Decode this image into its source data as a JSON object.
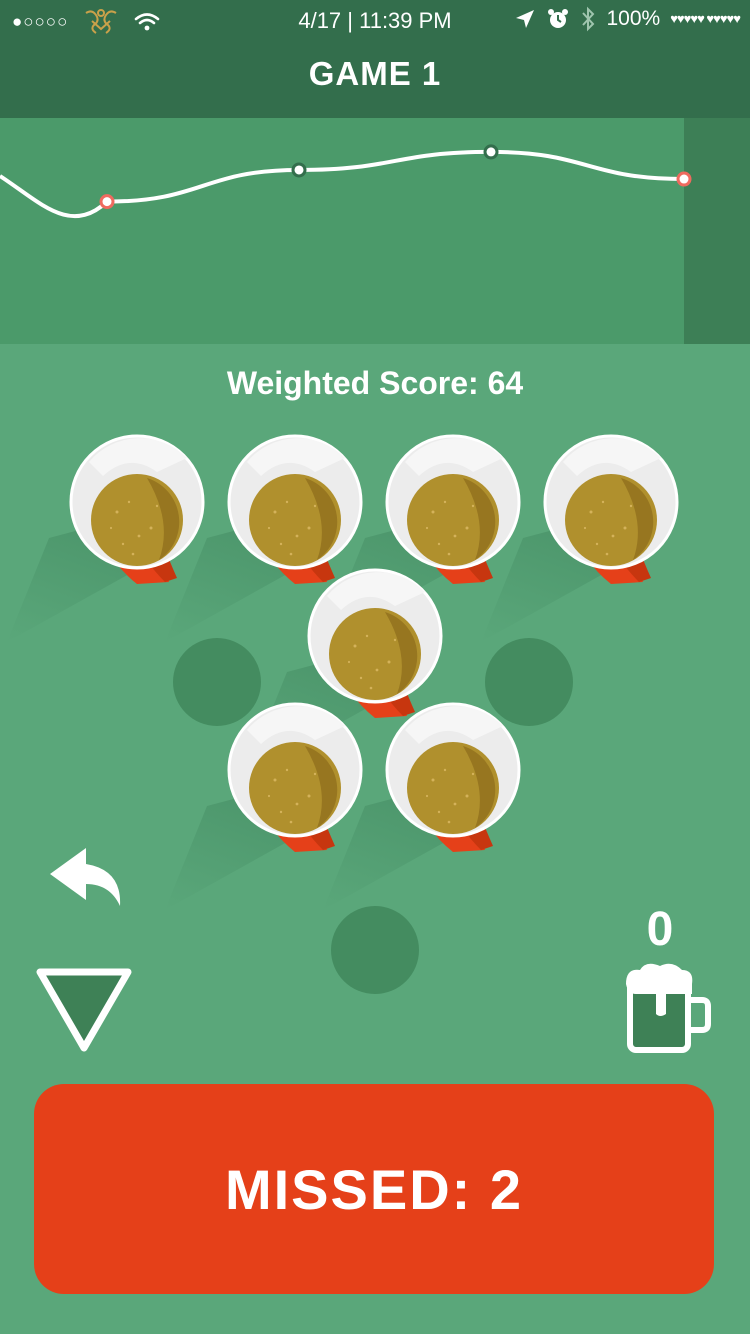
{
  "status_bar": {
    "signal": "●○○○○",
    "time": "4/17 | 11:39 PM",
    "battery": "100%",
    "hearts": "♥♥♥♥♥ ♥♥♥♥♥"
  },
  "header": {
    "title": "GAME 1"
  },
  "score": {
    "label": "Weighted Score: 64"
  },
  "colors": {
    "header_bg": "#336e4c",
    "chart_bg": "#4b9a6a",
    "table_bg": "#5aa77a",
    "empty_slot": "#448c60",
    "cup_red": "#e54019",
    "beer": "#b0902d",
    "miss_marker": "#ef6a5f"
  },
  "trend": {
    "points": [
      {
        "value": 0.63,
        "result": "miss"
      },
      {
        "value": 0.77,
        "result": "hit"
      },
      {
        "value": 0.85,
        "result": "hit"
      },
      {
        "value": 0.73,
        "result": "miss"
      }
    ]
  },
  "rack": {
    "cups": [
      {
        "id": "cup-1",
        "present": true
      },
      {
        "id": "cup-2",
        "present": true
      },
      {
        "id": "cup-3",
        "present": true
      },
      {
        "id": "cup-4",
        "present": true
      },
      {
        "id": "cup-5",
        "present": true
      },
      {
        "id": "cup-6",
        "present": false
      },
      {
        "id": "cup-7",
        "present": false
      },
      {
        "id": "cup-8",
        "present": true
      },
      {
        "id": "cup-9",
        "present": true
      },
      {
        "id": "cup-10",
        "present": false
      }
    ]
  },
  "controls": {
    "undo_icon": "undo-arrow-icon",
    "down_icon": "triangle-down-icon",
    "drink_icon": "beer-mug-icon",
    "drinks_count": "0"
  },
  "missed_button": {
    "label": "MISSED: 2"
  }
}
